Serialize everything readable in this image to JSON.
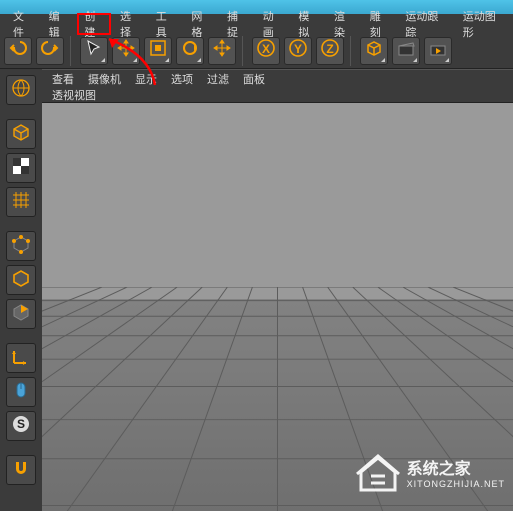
{
  "menu": {
    "items": [
      "文件",
      "编辑",
      "创建",
      "选择",
      "工具",
      "网格",
      "捕捉",
      "动画",
      "模拟",
      "渲染",
      "雕刻",
      "运动跟踪",
      "运动图形"
    ]
  },
  "toolbar": {
    "tips": [
      "undo",
      "redo",
      "select",
      "live-select",
      "move",
      "rotate",
      "scale",
      "axis-x",
      "axis-y",
      "axis-z",
      "cube-primitive",
      "render",
      "render-settings"
    ]
  },
  "vp_menu": {
    "items": [
      "查看",
      "摄像机",
      "显示",
      "选项",
      "过滤",
      "面板"
    ]
  },
  "vp_label": "透视视图",
  "watermark": {
    "title": "系统之家",
    "url": "XITONGZHIJIA.NET"
  },
  "axes": {
    "x": "X",
    "y": "Y",
    "z": "Z"
  }
}
